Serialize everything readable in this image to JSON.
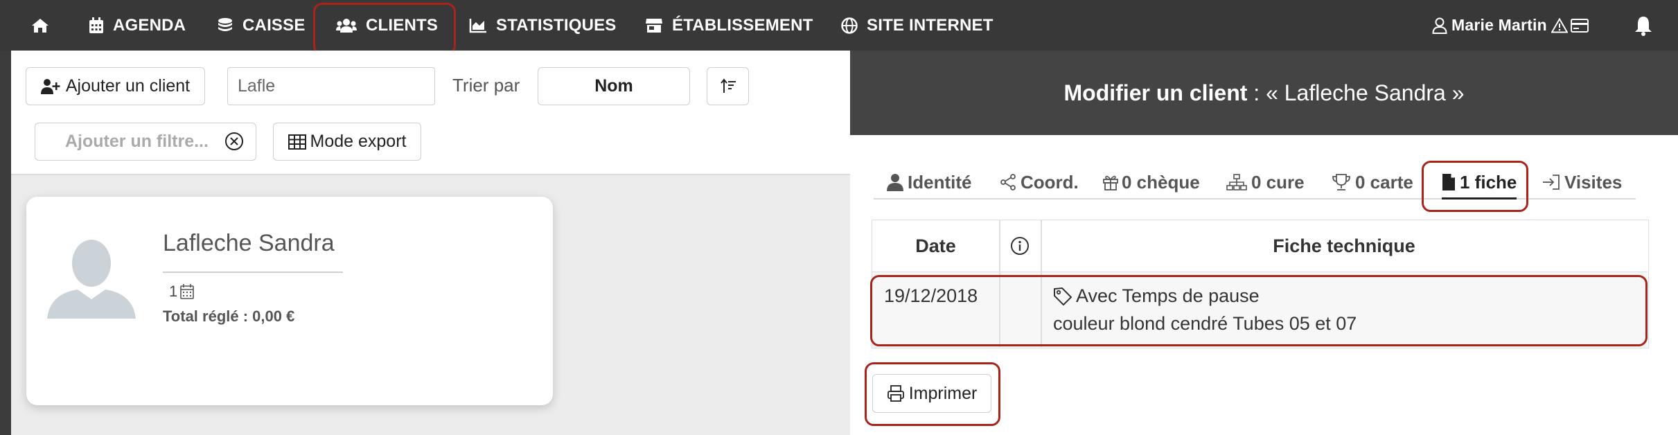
{
  "nav": {
    "items": [
      {
        "label": ""
      },
      {
        "label": "AGENDA"
      },
      {
        "label": "CAISSE"
      },
      {
        "label": "CLIENTS"
      },
      {
        "label": "STATISTIQUES"
      },
      {
        "label": "ÉTABLISSEMENT"
      },
      {
        "label": "SITE INTERNET"
      }
    ],
    "user_name": "Marie Martin"
  },
  "toolbar": {
    "add_client_label": "Ajouter un client",
    "search_value": "Lafle",
    "sort_label": "Trier par",
    "sort_value": "Nom",
    "filter_placeholder": "Ajouter un filtre...",
    "export_label": "Mode export"
  },
  "client_card": {
    "name": "Lafleche Sandra",
    "visit_count": "1",
    "total_label": "Total réglé : 0,00 €"
  },
  "panel": {
    "title_prefix": "Modifier un client",
    "title_rest": " : « Lafleche Sandra »",
    "tabs": [
      {
        "label": "Identité"
      },
      {
        "label": "Coord."
      },
      {
        "label": "0 chèque"
      },
      {
        "label": "0 cure"
      },
      {
        "label": "0 carte"
      },
      {
        "label": "1 fiche"
      },
      {
        "label": "Visites"
      }
    ],
    "table": {
      "headers": [
        "Date",
        "",
        "Fiche technique"
      ],
      "rows": [
        {
          "date": "19/12/2018",
          "title": "Avec Temps de pause",
          "detail": "couleur blond cendré Tubes 05 et 07"
        }
      ]
    },
    "print_label": "Imprimer"
  },
  "colors": {
    "nav_bg": "#383838",
    "panel_head_bg": "#444444",
    "highlight": "#a8241b"
  }
}
